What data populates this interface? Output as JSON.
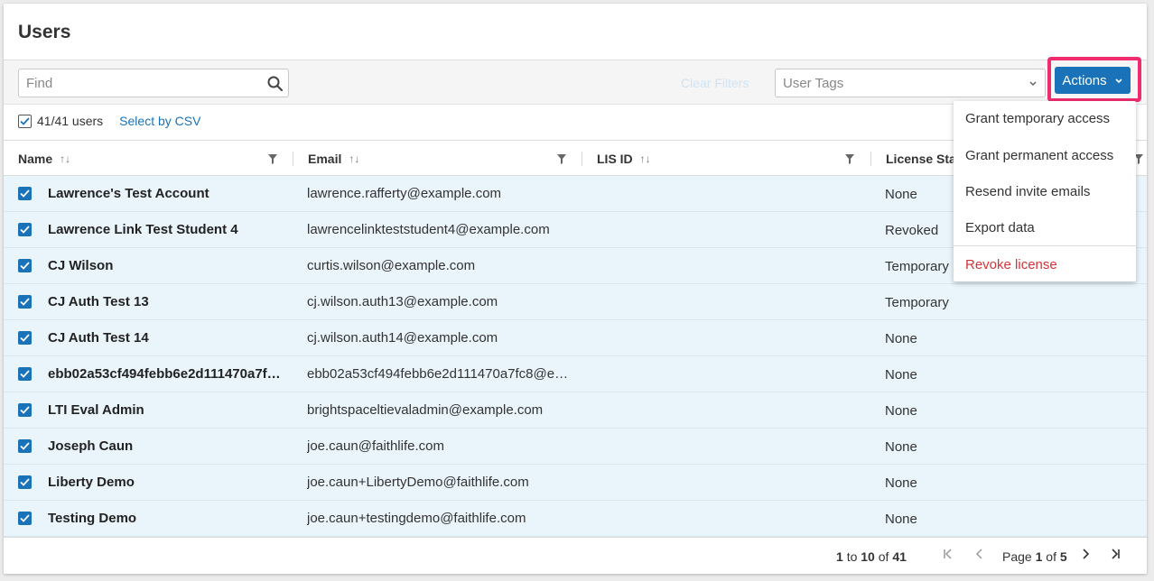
{
  "page": {
    "title": "Users"
  },
  "toolbar": {
    "find_placeholder": "Find",
    "clear_filters": "Clear Filters",
    "tags_placeholder": "User Tags",
    "actions_label": "Actions"
  },
  "selection": {
    "count": "41/41 users",
    "csv_link": "Select by CSV"
  },
  "columns": {
    "name": "Name",
    "email": "Email",
    "lis": "LIS ID",
    "license": "License Sta"
  },
  "rows": [
    {
      "name": "Lawrence's Test Account",
      "email": "lawrence.rafferty@example.com",
      "license": "None"
    },
    {
      "name": "Lawrence Link Test Student 4",
      "email": "lawrencelinkteststudent4@example.com",
      "license": "Revoked"
    },
    {
      "name": "CJ Wilson",
      "email": "curtis.wilson@example.com",
      "license": "Temporary"
    },
    {
      "name": "CJ Auth Test 13",
      "email": "cj.wilson.auth13@example.com",
      "license": "Temporary"
    },
    {
      "name": "CJ Auth Test 14",
      "email": "cj.wilson.auth14@example.com",
      "license": "None"
    },
    {
      "name": "ebb02a53cf494febb6e2d111470a7f…",
      "email": "ebb02a53cf494febb6e2d111470a7fc8@e…",
      "license": "None"
    },
    {
      "name": "LTI Eval Admin",
      "email": "brightspaceltievaladmin@example.com",
      "license": "None"
    },
    {
      "name": "Joseph Caun",
      "email": "joe.caun@faithlife.com",
      "license": "None"
    },
    {
      "name": "Liberty Demo",
      "email": "joe.caun+LibertyDemo@faithlife.com",
      "license": "None"
    },
    {
      "name": "Testing Demo",
      "email": "joe.caun+testingdemo@faithlife.com",
      "license": "None"
    }
  ],
  "menu": {
    "items": [
      "Grant temporary access",
      "Grant permanent access",
      "Resend invite emails",
      "Export data"
    ],
    "danger": "Revoke license"
  },
  "footer": {
    "range_start": "1",
    "range_to": "to",
    "range_end": "10",
    "range_of": "of",
    "range_total": "41",
    "page_label": "Page",
    "page_current": "1",
    "page_of": "of",
    "page_total": "5"
  },
  "colors": {
    "accent": "#1a73b8",
    "highlight": "#ee2c6f",
    "danger": "#d13438",
    "row_bg": "#eaf4fb"
  }
}
